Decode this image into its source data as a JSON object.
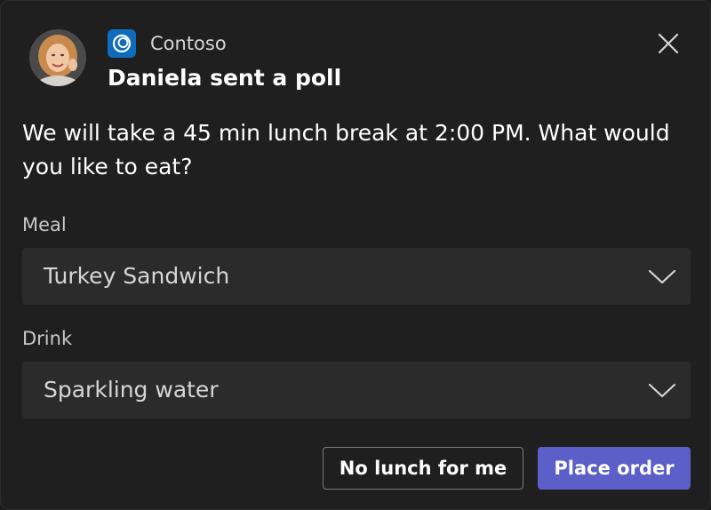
{
  "header": {
    "app_name": "Contoso",
    "title": "Daniela sent a poll",
    "avatar": "sender-avatar-photo",
    "app_icon": "contoso-logo-icon",
    "close_icon": "close-icon"
  },
  "message": "We will take a 45 min lunch break at 2:00 PM. What would you like to eat?",
  "fields": [
    {
      "label": "Meal",
      "value": "Turkey Sandwich"
    },
    {
      "label": "Drink",
      "value": "Sparkling water"
    }
  ],
  "actions": {
    "secondary_label": "No lunch for me",
    "primary_label": "Place order"
  },
  "colors": {
    "background": "#1f1f1f",
    "input_background": "#2b2b2b",
    "primary_button": "#5b5fc7",
    "app_icon": "#0f6cbd"
  }
}
